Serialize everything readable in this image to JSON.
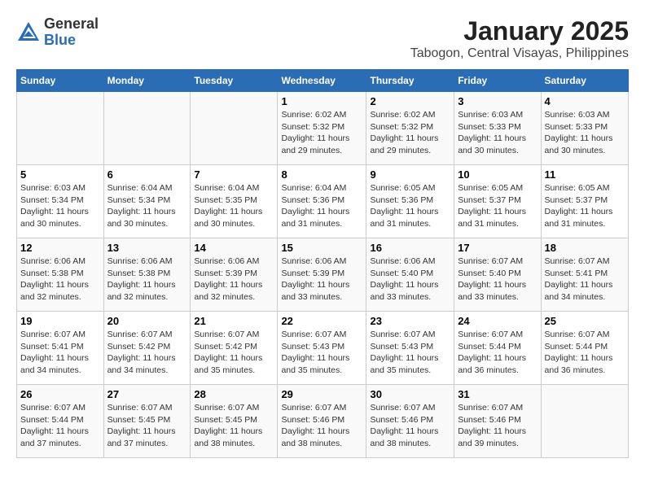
{
  "header": {
    "logo_general": "General",
    "logo_blue": "Blue",
    "title": "January 2025",
    "subtitle": "Tabogon, Central Visayas, Philippines"
  },
  "calendar": {
    "days_of_week": [
      "Sunday",
      "Monday",
      "Tuesday",
      "Wednesday",
      "Thursday",
      "Friday",
      "Saturday"
    ],
    "weeks": [
      [
        {
          "day": "",
          "info": ""
        },
        {
          "day": "",
          "info": ""
        },
        {
          "day": "",
          "info": ""
        },
        {
          "day": "1",
          "info": "Sunrise: 6:02 AM\nSunset: 5:32 PM\nDaylight: 11 hours and 29 minutes."
        },
        {
          "day": "2",
          "info": "Sunrise: 6:02 AM\nSunset: 5:32 PM\nDaylight: 11 hours and 29 minutes."
        },
        {
          "day": "3",
          "info": "Sunrise: 6:03 AM\nSunset: 5:33 PM\nDaylight: 11 hours and 30 minutes."
        },
        {
          "day": "4",
          "info": "Sunrise: 6:03 AM\nSunset: 5:33 PM\nDaylight: 11 hours and 30 minutes."
        }
      ],
      [
        {
          "day": "5",
          "info": "Sunrise: 6:03 AM\nSunset: 5:34 PM\nDaylight: 11 hours and 30 minutes."
        },
        {
          "day": "6",
          "info": "Sunrise: 6:04 AM\nSunset: 5:34 PM\nDaylight: 11 hours and 30 minutes."
        },
        {
          "day": "7",
          "info": "Sunrise: 6:04 AM\nSunset: 5:35 PM\nDaylight: 11 hours and 30 minutes."
        },
        {
          "day": "8",
          "info": "Sunrise: 6:04 AM\nSunset: 5:36 PM\nDaylight: 11 hours and 31 minutes."
        },
        {
          "day": "9",
          "info": "Sunrise: 6:05 AM\nSunset: 5:36 PM\nDaylight: 11 hours and 31 minutes."
        },
        {
          "day": "10",
          "info": "Sunrise: 6:05 AM\nSunset: 5:37 PM\nDaylight: 11 hours and 31 minutes."
        },
        {
          "day": "11",
          "info": "Sunrise: 6:05 AM\nSunset: 5:37 PM\nDaylight: 11 hours and 31 minutes."
        }
      ],
      [
        {
          "day": "12",
          "info": "Sunrise: 6:06 AM\nSunset: 5:38 PM\nDaylight: 11 hours and 32 minutes."
        },
        {
          "day": "13",
          "info": "Sunrise: 6:06 AM\nSunset: 5:38 PM\nDaylight: 11 hours and 32 minutes."
        },
        {
          "day": "14",
          "info": "Sunrise: 6:06 AM\nSunset: 5:39 PM\nDaylight: 11 hours and 32 minutes."
        },
        {
          "day": "15",
          "info": "Sunrise: 6:06 AM\nSunset: 5:39 PM\nDaylight: 11 hours and 33 minutes."
        },
        {
          "day": "16",
          "info": "Sunrise: 6:06 AM\nSunset: 5:40 PM\nDaylight: 11 hours and 33 minutes."
        },
        {
          "day": "17",
          "info": "Sunrise: 6:07 AM\nSunset: 5:40 PM\nDaylight: 11 hours and 33 minutes."
        },
        {
          "day": "18",
          "info": "Sunrise: 6:07 AM\nSunset: 5:41 PM\nDaylight: 11 hours and 34 minutes."
        }
      ],
      [
        {
          "day": "19",
          "info": "Sunrise: 6:07 AM\nSunset: 5:41 PM\nDaylight: 11 hours and 34 minutes."
        },
        {
          "day": "20",
          "info": "Sunrise: 6:07 AM\nSunset: 5:42 PM\nDaylight: 11 hours and 34 minutes."
        },
        {
          "day": "21",
          "info": "Sunrise: 6:07 AM\nSunset: 5:42 PM\nDaylight: 11 hours and 35 minutes."
        },
        {
          "day": "22",
          "info": "Sunrise: 6:07 AM\nSunset: 5:43 PM\nDaylight: 11 hours and 35 minutes."
        },
        {
          "day": "23",
          "info": "Sunrise: 6:07 AM\nSunset: 5:43 PM\nDaylight: 11 hours and 35 minutes."
        },
        {
          "day": "24",
          "info": "Sunrise: 6:07 AM\nSunset: 5:44 PM\nDaylight: 11 hours and 36 minutes."
        },
        {
          "day": "25",
          "info": "Sunrise: 6:07 AM\nSunset: 5:44 PM\nDaylight: 11 hours and 36 minutes."
        }
      ],
      [
        {
          "day": "26",
          "info": "Sunrise: 6:07 AM\nSunset: 5:44 PM\nDaylight: 11 hours and 37 minutes."
        },
        {
          "day": "27",
          "info": "Sunrise: 6:07 AM\nSunset: 5:45 PM\nDaylight: 11 hours and 37 minutes."
        },
        {
          "day": "28",
          "info": "Sunrise: 6:07 AM\nSunset: 5:45 PM\nDaylight: 11 hours and 38 minutes."
        },
        {
          "day": "29",
          "info": "Sunrise: 6:07 AM\nSunset: 5:46 PM\nDaylight: 11 hours and 38 minutes."
        },
        {
          "day": "30",
          "info": "Sunrise: 6:07 AM\nSunset: 5:46 PM\nDaylight: 11 hours and 38 minutes."
        },
        {
          "day": "31",
          "info": "Sunrise: 6:07 AM\nSunset: 5:46 PM\nDaylight: 11 hours and 39 minutes."
        },
        {
          "day": "",
          "info": ""
        }
      ]
    ]
  }
}
